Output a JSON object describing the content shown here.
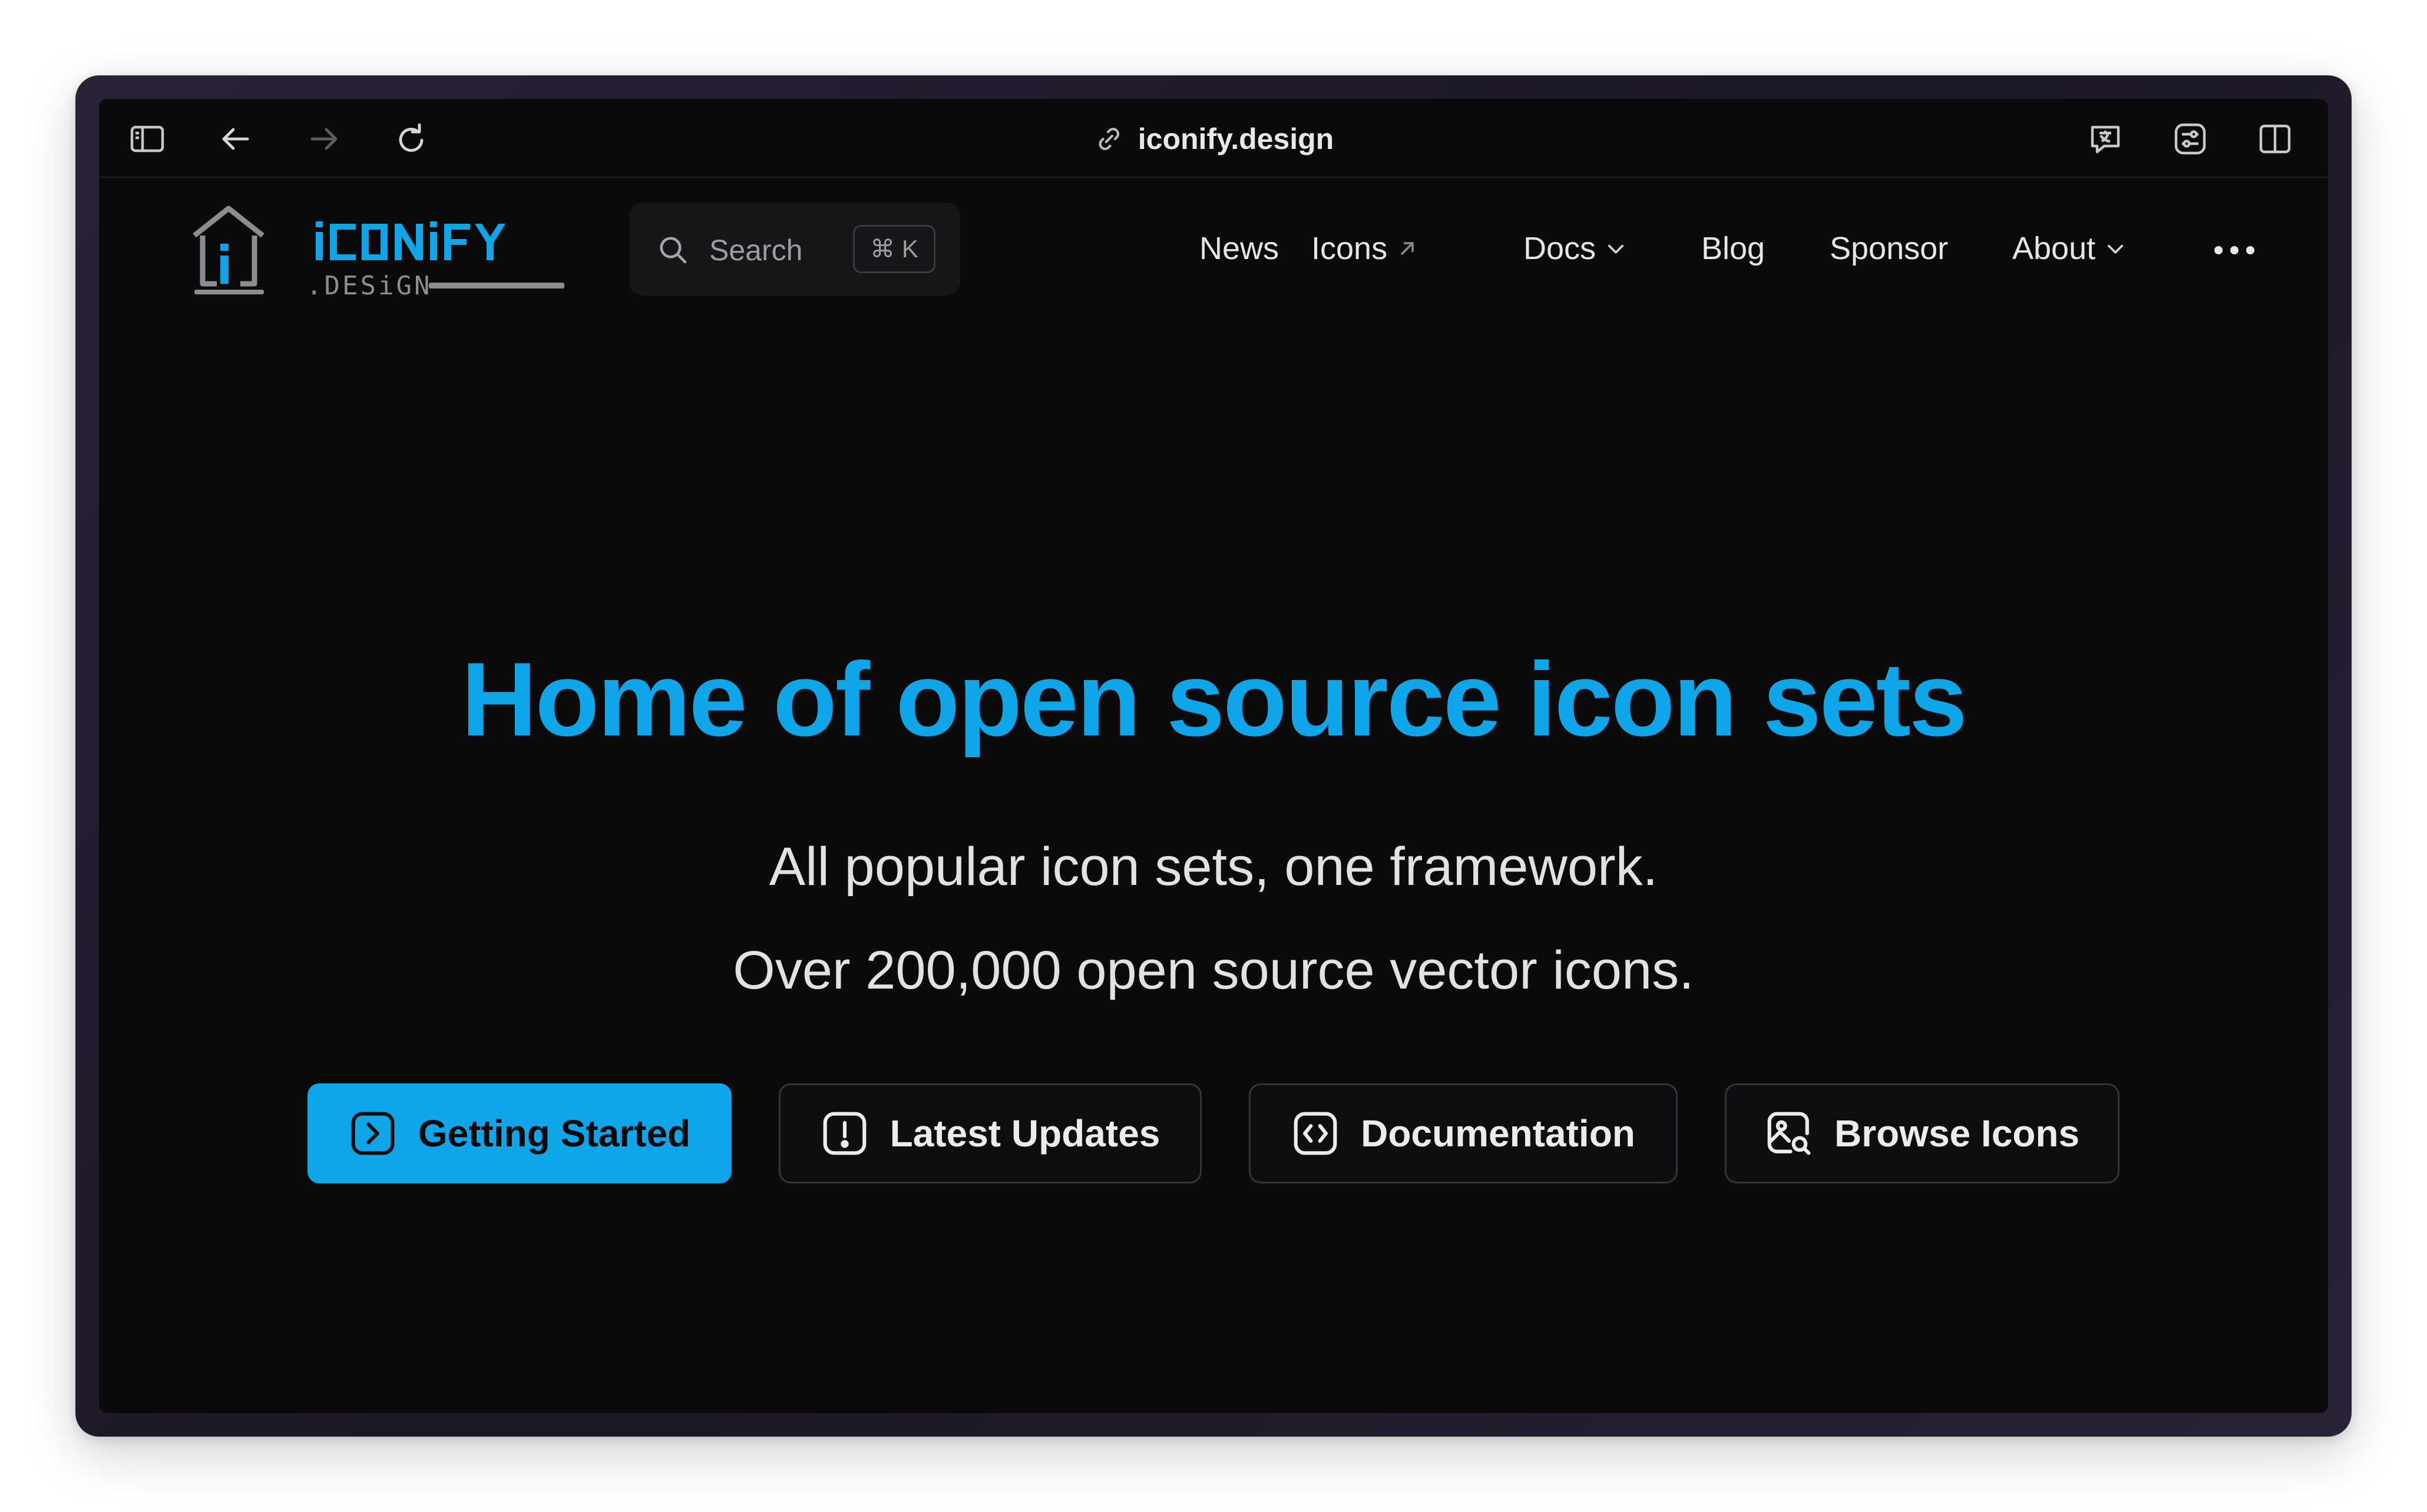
{
  "browser": {
    "url": "iconify.design"
  },
  "site": {
    "logo": {
      "name": "iconify",
      "sub": ".design"
    }
  },
  "search": {
    "label": "Search",
    "shortcut": "⌘ K"
  },
  "nav": {
    "items": [
      {
        "label": "News"
      },
      {
        "label": "Icons",
        "external": true
      },
      {
        "label": "Docs",
        "dropdown": true
      },
      {
        "label": "Blog"
      },
      {
        "label": "Sponsor"
      },
      {
        "label": "About",
        "dropdown": true
      }
    ]
  },
  "hero": {
    "title": "Home of open source icon sets",
    "subtitle_line1": "All popular icon sets, one framework.",
    "subtitle_line2": "Over 200,000 open source vector icons."
  },
  "buttons": [
    {
      "label": "Getting Started",
      "icon": "arrow-right-square-icon"
    },
    {
      "label": "Latest Updates",
      "icon": "alert-square-icon"
    },
    {
      "label": "Documentation",
      "icon": "code-square-icon"
    },
    {
      "label": "Browse Icons",
      "icon": "image-search-icon"
    }
  ],
  "colors": {
    "accent": "#0ea5e9",
    "background": "#0b0b0c",
    "text": "#e6e6e8"
  }
}
